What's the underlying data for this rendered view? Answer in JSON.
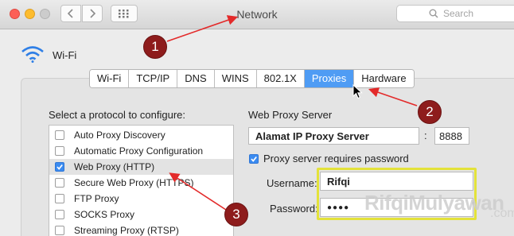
{
  "window": {
    "title": "Network",
    "search_placeholder": "Search"
  },
  "network": {
    "service_name": "Wi-Fi"
  },
  "tabs": [
    {
      "label": "Wi-Fi",
      "selected": false
    },
    {
      "label": "TCP/IP",
      "selected": false
    },
    {
      "label": "DNS",
      "selected": false
    },
    {
      "label": "WINS",
      "selected": false
    },
    {
      "label": "802.1X",
      "selected": false
    },
    {
      "label": "Proxies",
      "selected": true
    },
    {
      "label": "Hardware",
      "selected": false
    }
  ],
  "protocols": {
    "heading": "Select a protocol to configure:",
    "items": [
      {
        "label": "Auto Proxy Discovery",
        "checked": false,
        "selected": false
      },
      {
        "label": "Automatic Proxy Configuration",
        "checked": false,
        "selected": false
      },
      {
        "label": "Web Proxy (HTTP)",
        "checked": true,
        "selected": true
      },
      {
        "label": "Secure Web Proxy (HTTPS)",
        "checked": false,
        "selected": false
      },
      {
        "label": "FTP Proxy",
        "checked": false,
        "selected": false
      },
      {
        "label": "SOCKS Proxy",
        "checked": false,
        "selected": false
      },
      {
        "label": "Streaming Proxy (RTSP)",
        "checked": false,
        "selected": false
      }
    ]
  },
  "web_proxy": {
    "heading": "Web Proxy Server",
    "server": "Alamat IP Proxy Server",
    "separator": ":",
    "port": "8888",
    "requires_password_label": "Proxy server requires password",
    "requires_password": true,
    "username_label": "Username:",
    "username": "Rifqi",
    "password_label": "Password:",
    "password_mask": "●●●●"
  },
  "watermark": {
    "text": "RifqiMulyawan",
    "suffix": ".com"
  },
  "annotations": [
    "1",
    "2",
    "3"
  ],
  "colors": {
    "accent": "#4f9cf4",
    "annotation": "#8e1c1c",
    "arrow": "#e32a2a",
    "highlight": "#e3e23a"
  }
}
